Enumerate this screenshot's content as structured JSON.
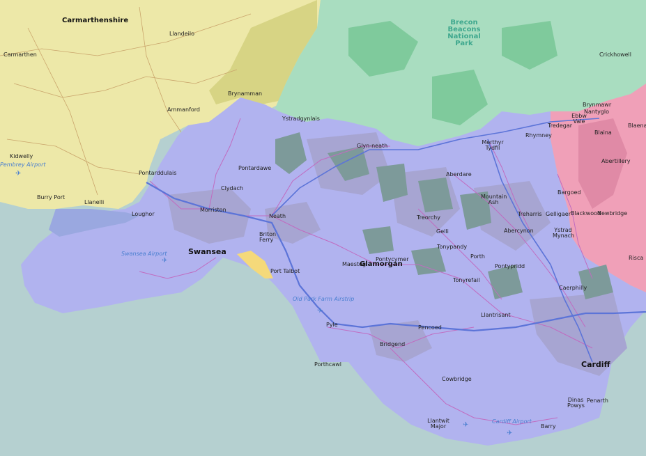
{
  "map": {
    "colors": {
      "sea": "#b5d0d0",
      "carmarthenshire": "#ede8a8",
      "brecon_beacons": "#a9ddc0",
      "glamorgan": "#b1b3ef",
      "blaenau": "#f0a0b8",
      "urban": "#a7a5d2",
      "woodland": "#7d9a9a",
      "motorway": "#5c74d8",
      "roads": "#c06cc0"
    },
    "counties": {
      "carmarthenshire": "Carmarthenshire",
      "glamorgan": "Glamorgan",
      "park": "Brecon Beacons National Park"
    },
    "cities": {
      "swansea": "Swansea",
      "cardiff": "Cardiff"
    },
    "towns": [
      "Carmarthen",
      "Llandeilo",
      "Brynamman",
      "Ammanford",
      "Ystradgynlais",
      "Kidwelly",
      "Pontarddulais",
      "Burry Port",
      "Llanelli",
      "Loughor",
      "Pontardawe",
      "Clydach",
      "Morriston",
      "Neath",
      "Briton Ferry",
      "Port Talbot",
      "Glyn-neath",
      "Merthyr Tydfil",
      "Rhymney",
      "Tredegar",
      "Ebbw Vale",
      "Brynmawr",
      "Nantyglo",
      "Blaina",
      "Blaenavon",
      "Crickhowell",
      "Abertillery",
      "Aberdare",
      "Mountain Ash",
      "Bargoed",
      "Treorchy",
      "Gelli",
      "Tonypandy",
      "Porth",
      "Treharris",
      "Gelligaer",
      "Abercynon",
      "Ystrad Mynach",
      "Blackwood",
      "Newbridge",
      "Risca",
      "Pontypridd",
      "Caerphilly",
      "Maesteg",
      "Pontycymer",
      "Tonyrefail",
      "Llantrisant",
      "Pyle",
      "Pencoed",
      "Bridgend",
      "Porthcawl",
      "Cowbridge",
      "Dinas Powys",
      "Penarth",
      "Llantwit Major",
      "Barry"
    ],
    "airports": [
      "Pembrey Airport",
      "Swansea Airport",
      "Old Park Farm Airstrip",
      "Cardiff Airport"
    ]
  }
}
